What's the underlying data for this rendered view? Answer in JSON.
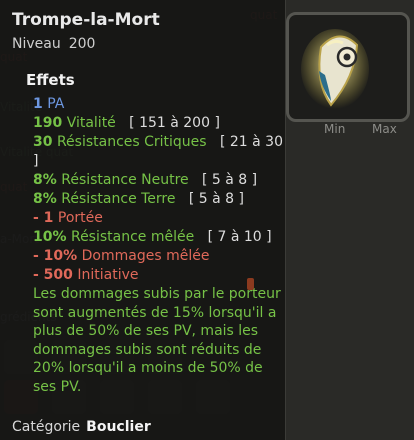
{
  "item": {
    "name": "Trompe-la-Mort",
    "level_label": "Niveau",
    "level_value": "200",
    "category_label": "Catégorie",
    "category_value": "Bouclier"
  },
  "effects_title": "Effets",
  "effects": [
    {
      "value": "1",
      "text": "PA",
      "range": "",
      "color": "blue"
    },
    {
      "value": "190",
      "text": "Vitalité",
      "range": "[ 151 à 200 ]",
      "color": "green"
    },
    {
      "value": "30",
      "text": "Résistances Critiques",
      "range": "[ 21 à 30 ]",
      "color": "green"
    },
    {
      "value": "8%",
      "text": "Résistance Neutre",
      "range": "[ 5 à 8 ]",
      "color": "green"
    },
    {
      "value": "8%",
      "text": "Résistance Terre",
      "range": "[ 5 à 8 ]",
      "color": "green"
    },
    {
      "value": "- 1",
      "text": "Portée",
      "range": "",
      "color": "red"
    },
    {
      "value": "10%",
      "text": "Résistance mêlée",
      "range": "[ 7 à 10 ]",
      "color": "green"
    },
    {
      "value": "- 10%",
      "text": "Dommages mêlée",
      "range": "",
      "color": "red"
    },
    {
      "value": "- 500",
      "text": "Initiative",
      "range": "",
      "color": "red"
    }
  ],
  "description": "Les dommages subis par le porteur sont augmentés de 15% lorsqu'il a plus de 50% de ses PV, mais les dommages subis sont réduits de 20% lorsqu'il a moins de 50% de ses PV.",
  "columns": {
    "min": "Min",
    "max": "Max"
  },
  "icons": {
    "item": "shield-icon"
  },
  "colors": {
    "blue": "#6d97e0",
    "green": "#76c247",
    "red": "#e0695a"
  }
}
